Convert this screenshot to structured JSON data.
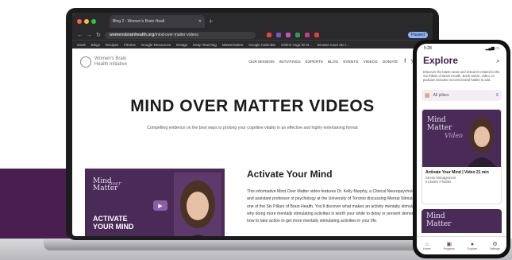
{
  "browser": {
    "tab_title": "Blog 2 - Women's Brain Healt",
    "url_bold": "womensbrainhealth.org",
    "url_rest": "/mind-over-matter-videos",
    "profile_label": "Paused",
    "bookmarks": [
      "Geek",
      "Blogs",
      "Recipes",
      "Fitness",
      "Google Resources",
      "Design",
      "Keep Teaching",
      "MasterSuites",
      "Google Calendar",
      "Online Yoga for B...",
      "Browse tours ato i..."
    ]
  },
  "site": {
    "logo_line1": "Women's Brain",
    "logo_line2": "Health Initiative",
    "nav": [
      "OUR MISSION",
      "INITIATIVES",
      "EXPERTS",
      "BLOG",
      "EVENTS",
      "VIDEOS",
      "DONATE"
    ],
    "page_title": "MIND OVER MATTER VIDEOS",
    "subtitle": "Compelling evidence on the best ways to prolong your cognitive vitality in an effective and highly entertaining format",
    "video": {
      "thumb_title_1": "Mind",
      "thumb_title_2": "Matter",
      "thumb_script": "over",
      "thumb_activate_1": "ACTIVATE",
      "thumb_activate_2": "YOUR MIND"
    },
    "section_title": "Activate Your Mind",
    "section_body": "This informative Mind Over Matter video features Dr. Kelly Murphy, a Clinical Neuropsychologist and assistant professor of psychology at the University of Toronto discussing Mental Stimulation as one of the Six Pillars of Brain Health. You'll discover what makes an activity mentally stimulating, why doing more mentally stimulating activities is worth your while to delay or prevent dementia and how to take action to get more mentally stimulating activities in your life."
  },
  "phone": {
    "time": "5:28",
    "title": "Explore",
    "description": "Discover the latest news and research related to the Six Pillars of Brain Health. Each article, video, or podcast includes recommended habits to add.",
    "filter_label": "All pillars",
    "card_title": "Activate Your Mind | Video 21 min",
    "card_category": "Stress Management",
    "card_habits": "Includes 9 habits",
    "card_thumb_1": "Mind",
    "card_thumb_2": "Matter",
    "card_thumb_video": "Video",
    "tabs": [
      "Home",
      "Progress",
      "Explore",
      "Settings"
    ]
  }
}
